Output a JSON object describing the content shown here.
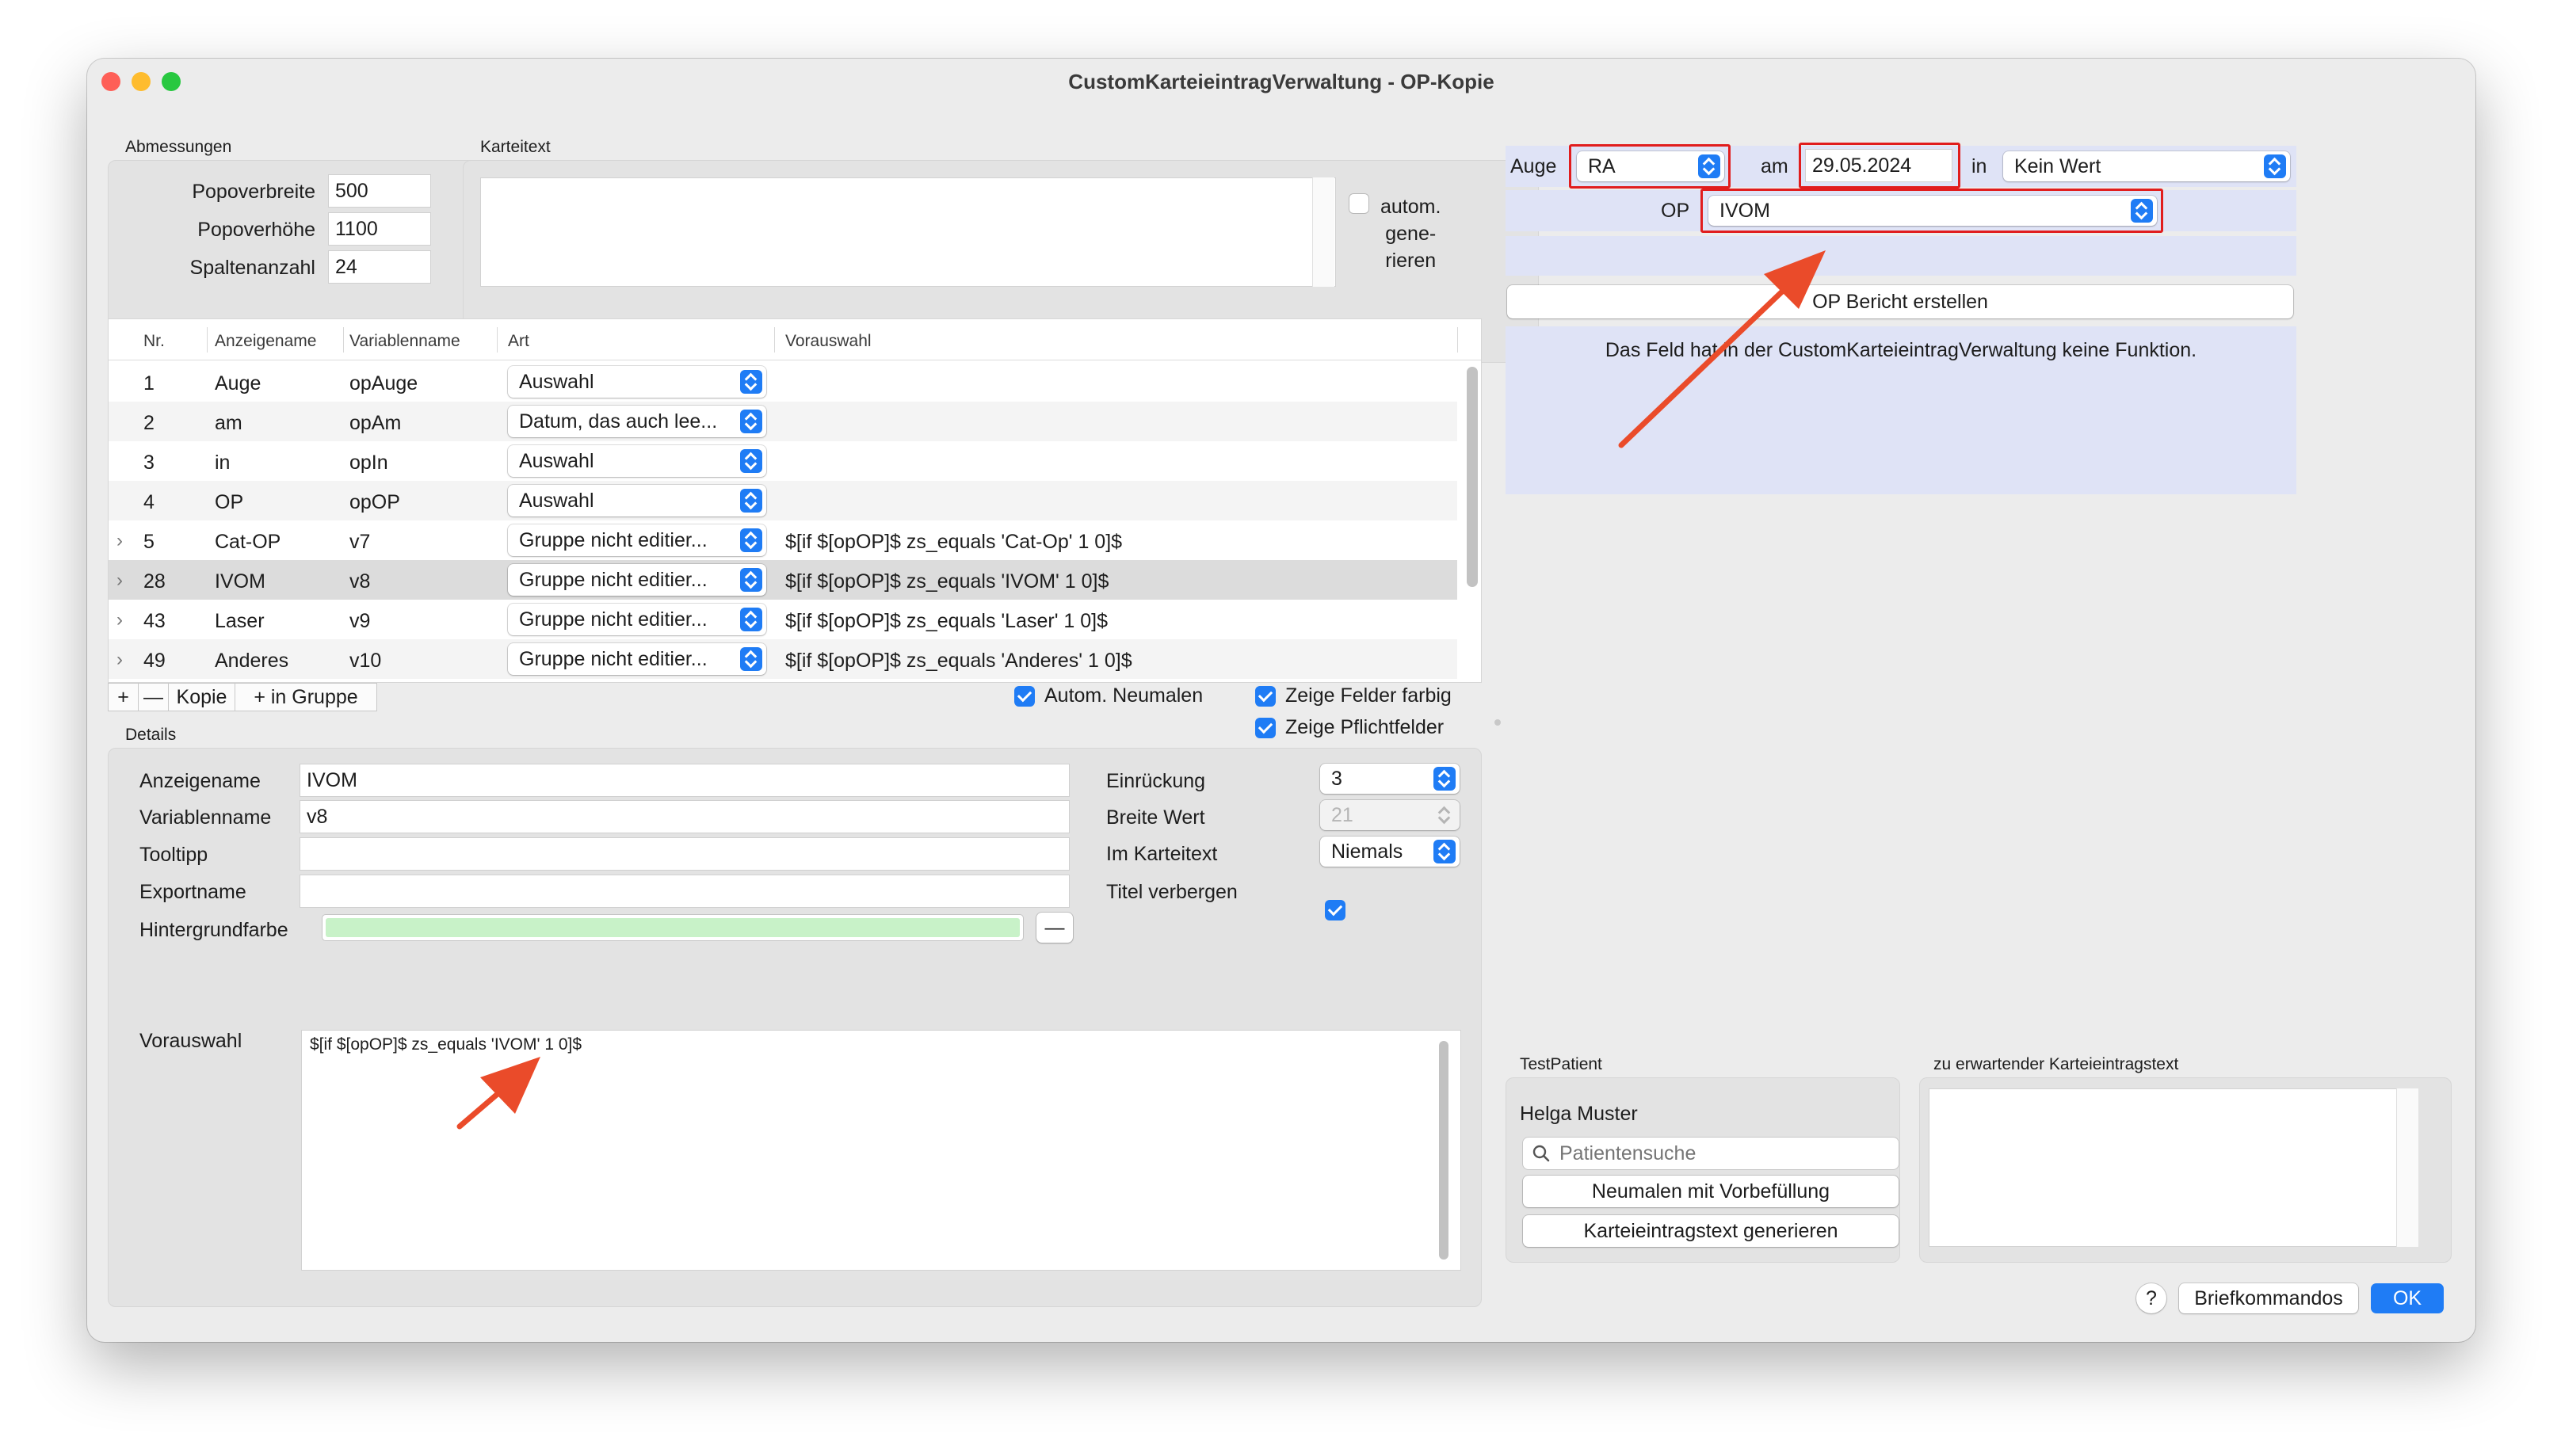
{
  "window": {
    "title": "CustomKarteieintragVerwaltung - OP-Kopie"
  },
  "abmessungen": {
    "title": "Abmessungen",
    "fields": [
      {
        "label": "Popoverbreite",
        "value": "500"
      },
      {
        "label": "Popoverhöhe",
        "value": "1100"
      },
      {
        "label": "Spaltenanzahl",
        "value": "24"
      }
    ]
  },
  "karteitext": {
    "title": "Karteitext",
    "value": "",
    "auto_label": "autom. gene- rieren",
    "auto_line1": "autom.",
    "auto_line2": "gene-",
    "auto_line3": "rieren",
    "auto_checked": false
  },
  "table": {
    "columns": [
      "Nr.",
      "Anzeigename",
      "Variablenname",
      "Art",
      "Vorauswahl"
    ],
    "rows": [
      {
        "expandable": false,
        "nr": "1",
        "anzeigename": "Auge",
        "variablenname": "opAuge",
        "art": "Auswahl",
        "vorauswahl": ""
      },
      {
        "expandable": false,
        "nr": "2",
        "anzeigename": "am",
        "variablenname": "opAm",
        "art": "Datum, das auch lee...",
        "vorauswahl": ""
      },
      {
        "expandable": false,
        "nr": "3",
        "anzeigename": "in",
        "variablenname": "opIn",
        "art": "Auswahl",
        "vorauswahl": ""
      },
      {
        "expandable": false,
        "nr": "4",
        "anzeigename": "OP",
        "variablenname": "opOP",
        "art": "Auswahl",
        "vorauswahl": ""
      },
      {
        "expandable": true,
        "nr": "5",
        "anzeigename": "Cat-OP",
        "variablenname": "v7",
        "art": "Gruppe nicht editier...",
        "vorauswahl": "$[if $[opOP]$ zs_equals 'Cat-Op' 1 0]$"
      },
      {
        "expandable": true,
        "nr": "28",
        "anzeigename": "IVOM",
        "variablenname": "v8",
        "art": "Gruppe nicht editier...",
        "vorauswahl": "$[if $[opOP]$ zs_equals 'IVOM' 1 0]$"
      },
      {
        "expandable": true,
        "nr": "43",
        "anzeigename": "Laser",
        "variablenname": "v9",
        "art": "Gruppe nicht editier...",
        "vorauswahl": "$[if $[opOP]$ zs_equals 'Laser' 1 0]$"
      },
      {
        "expandable": true,
        "nr": "49",
        "anzeigename": "Anderes",
        "variablenname": "v10",
        "art": "Gruppe nicht editier...",
        "vorauswahl": "$[if $[opOP]$ zs_equals 'Anderes' 1 0]$"
      }
    ],
    "selected_index": 5
  },
  "toolbar": {
    "add_label": "+",
    "remove_label": "—",
    "copy_label": "Kopie",
    "group_label": "+ in Gruppe",
    "auto_neumalen": "Autom. Neumalen",
    "zeige_farbig": "Zeige Felder farbig",
    "zeige_pflicht": "Zeige Pflichtfelder"
  },
  "details": {
    "title": "Details",
    "anzeigename_label": "Anzeigename",
    "anzeigename": "IVOM",
    "variablenname_label": "Variablenname",
    "variablenname": "v8",
    "tooltipp_label": "Tooltipp",
    "tooltipp": "",
    "exportname_label": "Exportname",
    "exportname": "",
    "hintergrund_label": "Hintergrundfarbe",
    "hintergrund_color": "#c8f2c8",
    "hintergrund_remove": "—",
    "einrueckung_label": "Einrückung",
    "einrueckung": "3",
    "breite_label": "Breite Wert",
    "breite": "21",
    "karteitext_label": "Im Karteitext",
    "karteitext": "Niemals",
    "titel_label": "Titel verbergen",
    "titel_checked": true,
    "vorauswahl_label": "Vorauswahl",
    "vorauswahl": "$[if $[opOP]$ zs_equals 'IVOM' 1 0]$"
  },
  "preview": {
    "auge_label": "Auge",
    "auge_value": "RA",
    "am_label": "am",
    "am_value": "29.05.2024",
    "in_label": "in",
    "in_value": "Kein Wert",
    "op_label": "OP",
    "op_value": "IVOM",
    "bericht_button": "OP Bericht erstellen",
    "info_text": "Das Feld hat in der CustomKarteieintragVerwaltung keine Funktion.",
    "highlight_color": "#e11d1d",
    "panel_color": "#dfe3f6"
  },
  "testpatient": {
    "title": "TestPatient",
    "name": "Helga Muster",
    "search_placeholder": "Patientensuche",
    "neumalen_button": "Neumalen mit Vorbefüllung",
    "generieren_button": "Karteieintragstext generieren"
  },
  "erwartet": {
    "title": "zu erwartender Karteieintragstext",
    "value": ""
  },
  "footer": {
    "help": "?",
    "briefkommandos": "Briefkommandos",
    "ok": "OK"
  },
  "colors": {
    "accent": "#1f7cf5",
    "annotation_arrow": "#ea4b2a"
  }
}
